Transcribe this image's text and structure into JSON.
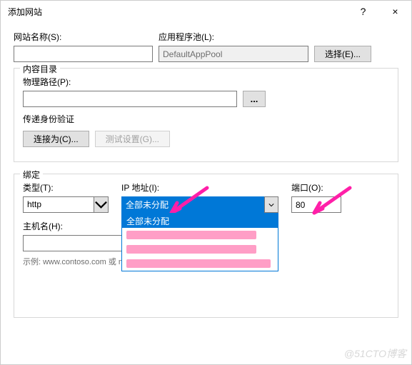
{
  "titlebar": {
    "title": "添加网站",
    "help": "?",
    "close": "×"
  },
  "site": {
    "name_label": "网站名称(S):",
    "name_value": "",
    "pool_label": "应用程序池(L):",
    "pool_value": "DefaultAppPool",
    "select_btn": "选择(E)..."
  },
  "content_dir": {
    "legend": "内容目录",
    "path_label": "物理路径(P):",
    "path_value": "",
    "browse": "...",
    "auth_label": "传递身份验证",
    "connect_as": "连接为(C)...",
    "test_settings": "测试设置(G)..."
  },
  "binding": {
    "legend": "绑定",
    "type_label": "类型(T):",
    "type_value": "http",
    "ip_label": "IP 地址(I):",
    "ip_value": "全部未分配",
    "ip_options": [
      "全部未分配",
      "",
      "",
      ""
    ],
    "port_label": "端口(O):",
    "port_value": "80",
    "host_label": "主机名(H):",
    "host_value": "",
    "example": "示例: www.contoso.com 或 marketing.contoso.com"
  },
  "watermark": "@51CTO博客"
}
